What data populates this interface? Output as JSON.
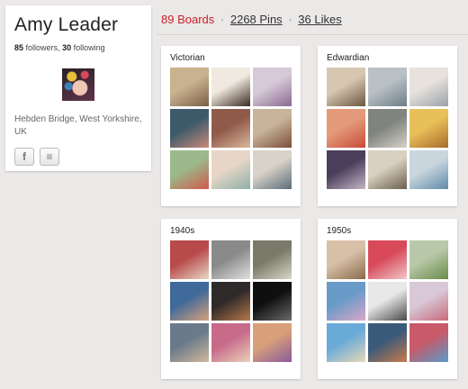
{
  "profile": {
    "name": "Amy Leader",
    "followers_count": "85",
    "followers_label": "followers,",
    "following_count": "30",
    "following_label": "following",
    "location": "Hebden Bridge, West Yorkshire, UK",
    "social": [
      {
        "icon": "facebook-icon",
        "glyph": "f"
      },
      {
        "icon": "rss-icon",
        "glyph": "≡"
      }
    ]
  },
  "nav": {
    "boards": "89 Boards",
    "pins": "2268 Pins",
    "likes": "36 Likes",
    "separator": "·"
  },
  "colors": {
    "accent": "#cb2027",
    "background": "#ebe8e8"
  },
  "boards": [
    {
      "title": "Victorian",
      "thumbs": [
        [
          "#c9b28f",
          "#7a5f45"
        ],
        [
          "#efe9df",
          "#3a2a22"
        ],
        [
          "#d6c9d8",
          "#8a6b8f"
        ],
        [
          "#3d5a6a",
          "#c98a7a"
        ],
        [
          "#8f5a4a",
          "#d9b89a"
        ],
        [
          "#c8b49a",
          "#7b4d3a"
        ],
        [
          "#9bb98a",
          "#d05a4a"
        ],
        [
          "#e7d6c8",
          "#8fb0a8"
        ],
        [
          "#d8d2c8",
          "#5a6d7a"
        ]
      ]
    },
    {
      "title": "Edwardian",
      "thumbs": [
        [
          "#d7c7b0",
          "#6b5640"
        ],
        [
          "#b9c1c6",
          "#6f7d86"
        ],
        [
          "#e7e2dc",
          "#9aa1a8"
        ],
        [
          "#e49a7a",
          "#c84a3a"
        ],
        [
          "#7f847e",
          "#d6d2c8"
        ],
        [
          "#e8c05a",
          "#a86a2a"
        ],
        [
          "#4a3f5a",
          "#c8b4c8"
        ],
        [
          "#d8d0c0",
          "#6b5f4f"
        ],
        [
          "#c9d6de",
          "#5f8aa8"
        ]
      ]
    },
    {
      "title": "1940s",
      "thumbs": [
        [
          "#b84a4a",
          "#e8d8c8"
        ],
        [
          "#8a8a8a",
          "#e0e0e0"
        ],
        [
          "#7a7a6a",
          "#d8d8c8"
        ],
        [
          "#3f6a9a",
          "#d8a07a"
        ],
        [
          "#2f2a2a",
          "#b8784a"
        ],
        [
          "#0f0f0f",
          "#6a6a6a"
        ],
        [
          "#6a7a8a",
          "#d0b89a"
        ],
        [
          "#c86a8a",
          "#e8d0b8"
        ],
        [
          "#d8a07a",
          "#8a5a9a"
        ]
      ]
    },
    {
      "title": "1950s",
      "thumbs": [
        [
          "#d8c0a8",
          "#8a6a4a"
        ],
        [
          "#d84a5a",
          "#f0c8c8"
        ],
        [
          "#b8c8a8",
          "#6a8a4a"
        ],
        [
          "#6a9ac8",
          "#d8a8c8"
        ],
        [
          "#e8e8e8",
          "#4a4a4a"
        ],
        [
          "#d8c8d8",
          "#c86a7a"
        ],
        [
          "#6aaad8",
          "#e8d8b8"
        ],
        [
          "#3a5a7a",
          "#c87a4a"
        ],
        [
          "#c85a6a",
          "#5a9ac8"
        ]
      ]
    }
  ]
}
